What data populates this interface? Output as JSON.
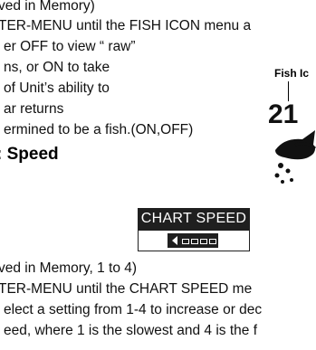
{
  "paragraph1": {
    "lines": [
      "ved in Memory)",
      "TER-MENU until the FISH ICON menu a",
      "er OFF to view “ raw”",
      "ns, or ON to take",
      "of Unit’s ability to",
      "ar returns",
      "ermined to be a fish.(ON,OFF)"
    ]
  },
  "fish_callout": {
    "label": "Fish Ic",
    "digits": "21"
  },
  "section_heading": ": Speed",
  "chart_speed": {
    "title": "CHART SPEED",
    "segments": 4
  },
  "paragraph2": {
    "lines": [
      "ved in Memory, 1 to 4)",
      "TER-MENU until the CHART SPEED me",
      "elect a setting from 1-4 to increase or dec",
      "eed, where 1 is the slowest and 4 is the f"
    ]
  }
}
